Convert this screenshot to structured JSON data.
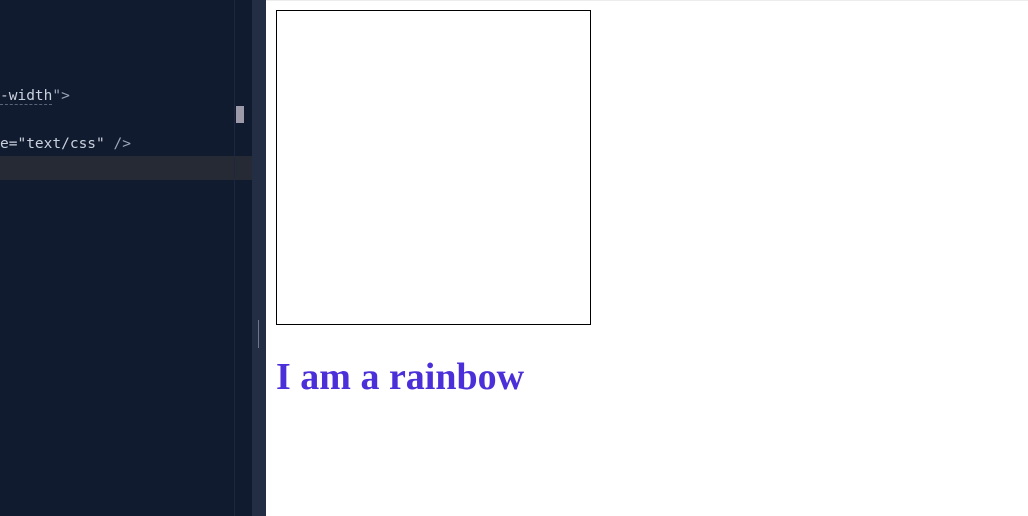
{
  "editor": {
    "lines": [
      {
        "prefix": "-width",
        "suffix": "\">"
      },
      {
        "prefix": "e=",
        "value": "\"text/css\"",
        "suffix": " />"
      }
    ]
  },
  "preview": {
    "heading": "I am a rainbow",
    "heading_color": "#4b2fd9"
  },
  "colors": {
    "editor_bg": "#111b30",
    "splitter_bg": "#232d44",
    "preview_bg": "#ffffff"
  }
}
